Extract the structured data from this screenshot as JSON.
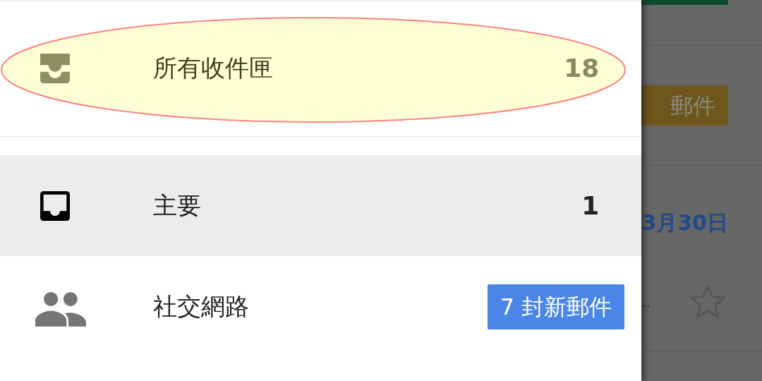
{
  "drawer": {
    "items": [
      {
        "label": "所有收件匣",
        "kind": "count",
        "count": "18",
        "selected": false,
        "highlighted": true
      },
      {
        "label": "主要",
        "kind": "count",
        "count": "1",
        "selected": true,
        "highlighted": false
      },
      {
        "label": "社交網路",
        "kind": "badge",
        "count": "7 封新郵件",
        "selected": false,
        "highlighted": false
      }
    ]
  },
  "background": {
    "badge": "郵件",
    "date": "3月30日",
    "snippet": "..",
    "starred": false
  }
}
